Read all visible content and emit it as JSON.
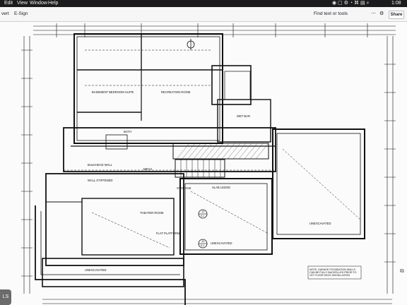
{
  "menubar": {
    "items": [
      "Edit",
      "View",
      "Window",
      "Help"
    ],
    "clock": "1:08"
  },
  "toolbar": {
    "left_items": [
      "vert",
      "E-Sign"
    ],
    "find_label": "Find text or tools",
    "share_label": "Share"
  },
  "page": {
    "chip_label": "LS"
  },
  "plan": {
    "labels": {
      "basement_bedroom_suite": "BASEMENT BEDROOM SUITE",
      "recreation_room": "RECREATION ROOM",
      "wet_bar": "WET BAR",
      "bath": "BATH",
      "mech": "MECH",
      "unexcavated_right": "UNEXCAVATED",
      "unexcavated_mid": "UNEXCAVATED",
      "unexcavated_bottom": "UNEXCAVATED",
      "theater_room": "THEATER ROOM",
      "wall_stiffened": "WALL STIFFENED",
      "bulkhead_wall": "BULKHEAD WALL",
      "flat_platform": "FLAT PLATFORM",
      "slab_ledge": "SLAB LEDGE",
      "storage": "STORAGE",
      "note": "NOTE: GARAGE FOUNDATION WALLS CAN BE FULLY BACKFILLED PRIOR TO 1ST FLOOR DECK INSTALLATION",
      "detail_a": "12",
      "detail_a_ref": "S-1",
      "detail_b": "10",
      "detail_b_ref": "S-1"
    }
  }
}
